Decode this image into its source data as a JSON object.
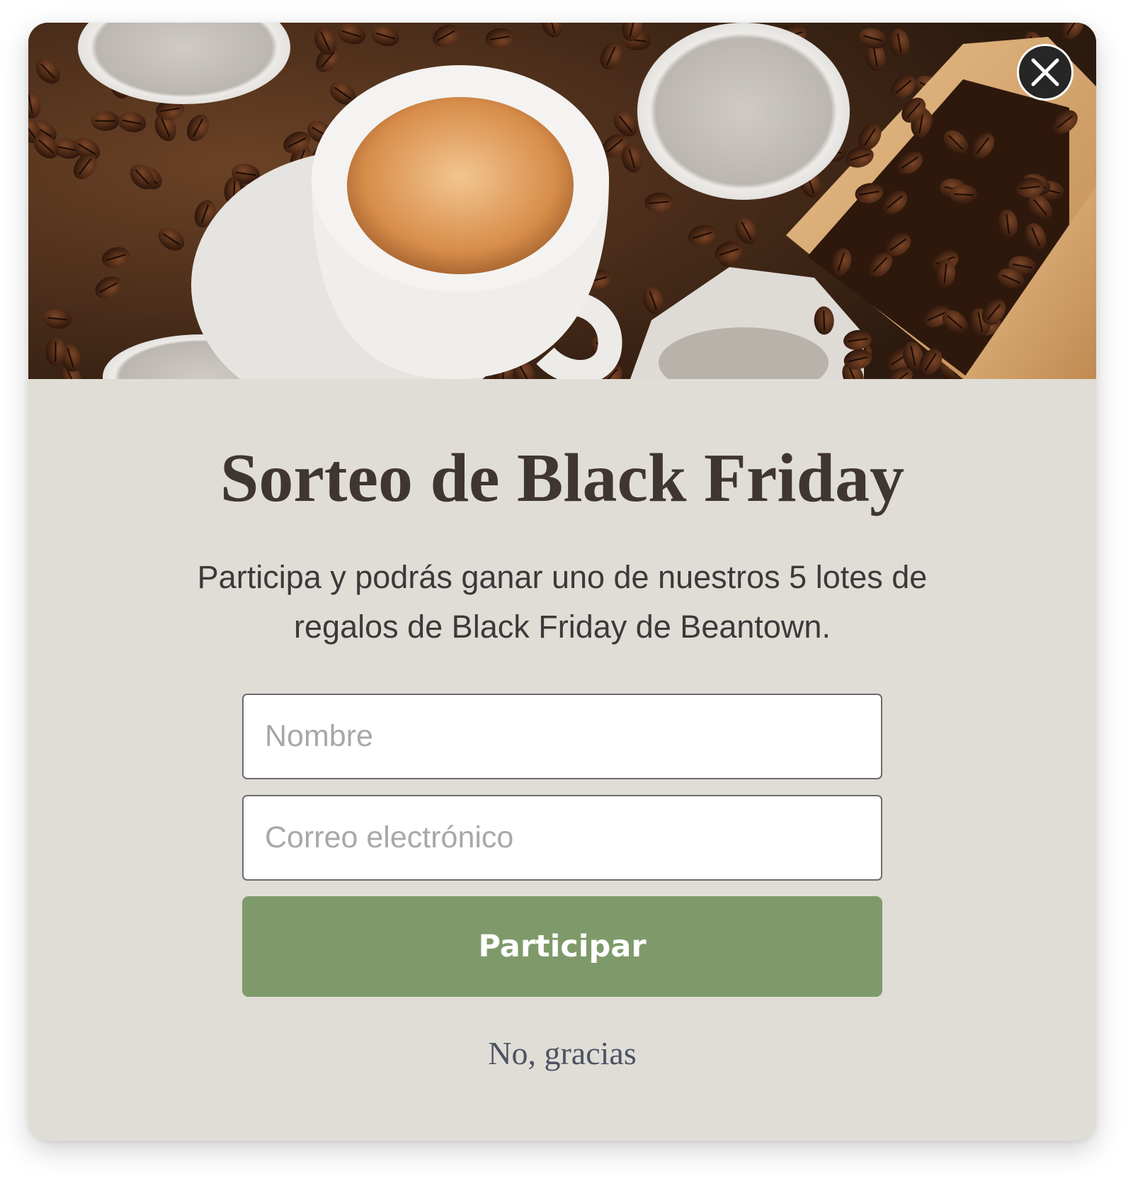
{
  "popup": {
    "image_alt": "Café espresso con granos de café y cápsulas",
    "close_icon": "close-icon",
    "title": "Sorteo de Black Friday",
    "description": "Participa y podrás ganar uno de nuestros 5 lotes de regalos de Black Friday de Beantown.",
    "name_field": {
      "placeholder": "Nombre",
      "value": ""
    },
    "email_field": {
      "placeholder": "Correo electrónico",
      "value": ""
    },
    "submit_label": "Participar",
    "decline_label": "No, gracias"
  },
  "colors": {
    "panel_background": "#e0ddd7",
    "button": "#7f9a6a",
    "title_text": "#3f3533",
    "close_button": "#262626"
  }
}
